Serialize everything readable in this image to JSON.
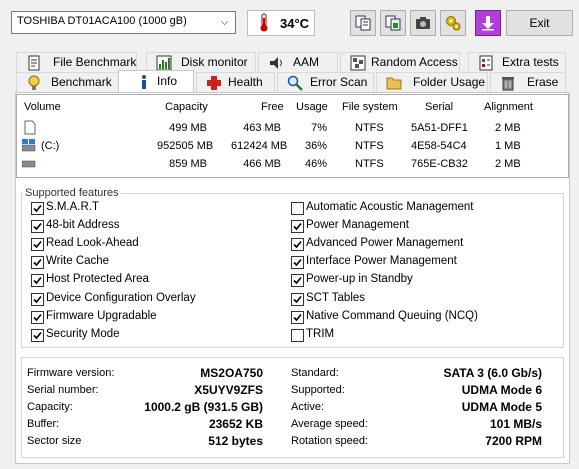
{
  "toolbar": {
    "drive_selected": "TOSHIBA DT01ACA100 (1000 gB)",
    "temperature": "34°C",
    "exit_label": "Exit"
  },
  "tabs_row1": [
    {
      "label": "File Benchmark",
      "icon": "file-benchmark-icon"
    },
    {
      "label": "Disk monitor",
      "icon": "disk-monitor-icon"
    },
    {
      "label": "AAM",
      "icon": "speaker-icon"
    },
    {
      "label": "Random Access",
      "icon": "random-access-icon"
    },
    {
      "label": "Extra tests",
      "icon": "extra-tests-icon"
    }
  ],
  "tabs_row2": [
    {
      "label": "Benchmark",
      "icon": "bulb-icon"
    },
    {
      "label": "Info",
      "icon": "info-icon",
      "active": true
    },
    {
      "label": "Health",
      "icon": "health-cross-icon"
    },
    {
      "label": "Error Scan",
      "icon": "magnifier-icon"
    },
    {
      "label": "Folder Usage",
      "icon": "folder-icon"
    },
    {
      "label": "Erase",
      "icon": "trash-icon"
    }
  ],
  "volumes": {
    "headers": [
      "Volume",
      "Capacity",
      "Free",
      "Usage",
      "File system",
      "Serial",
      "Alignment"
    ],
    "rows": [
      {
        "volume": "",
        "capacity": "499 MB",
        "free": "463 MB",
        "usage": "7%",
        "fs": "NTFS",
        "serial": "5A51-DFF1",
        "alignment": "2 MB"
      },
      {
        "volume": "(C:)",
        "capacity": "952505 MB",
        "free": "612424 MB",
        "usage": "36%",
        "fs": "NTFS",
        "serial": "4E58-54C4",
        "alignment": "1 MB"
      },
      {
        "volume": "",
        "capacity": "859 MB",
        "free": "466 MB",
        "usage": "46%",
        "fs": "NTFS",
        "serial": "765E-CB32",
        "alignment": "2 MB"
      }
    ]
  },
  "features": {
    "title": "Supported features",
    "left": [
      {
        "label": "S.M.A.R.T",
        "checked": true
      },
      {
        "label": "48-bit Address",
        "checked": true
      },
      {
        "label": "Read Look-Ahead",
        "checked": true
      },
      {
        "label": "Write Cache",
        "checked": true
      },
      {
        "label": "Host Protected Area",
        "checked": true
      },
      {
        "label": "Device Configuration Overlay",
        "checked": true
      },
      {
        "label": "Firmware Upgradable",
        "checked": true
      },
      {
        "label": "Security Mode",
        "checked": true
      }
    ],
    "right": [
      {
        "label": "Automatic Acoustic Management",
        "checked": false
      },
      {
        "label": "Power Management",
        "checked": true
      },
      {
        "label": "Advanced Power Management",
        "checked": true
      },
      {
        "label": "Interface Power Management",
        "checked": true
      },
      {
        "label": "Power-up in Standby",
        "checked": true
      },
      {
        "label": "SCT Tables",
        "checked": true
      },
      {
        "label": "Native Command Queuing (NCQ)",
        "checked": true
      },
      {
        "label": "TRIM",
        "checked": false
      }
    ]
  },
  "info": {
    "left": [
      {
        "label": "Firmware version:",
        "value": "MS2OA750"
      },
      {
        "label": "Serial number:",
        "value": "X5UYV9ZFS"
      },
      {
        "label": "Capacity:",
        "value": "1000.2 gB (931.5 GB)"
      },
      {
        "label": "Buffer:",
        "value": "23652 KB"
      },
      {
        "label": "Sector size",
        "value": "512 bytes"
      }
    ],
    "right": [
      {
        "label": "Standard:",
        "value": "SATA 3 (6.0 Gb/s)"
      },
      {
        "label": "Supported:",
        "value": "UDMA Mode 6"
      },
      {
        "label": "Active:",
        "value": "UDMA Mode 5"
      },
      {
        "label": "Average speed:",
        "value": "101 MB/s"
      },
      {
        "label": "Rotation speed:",
        "value": "7200 RPM"
      }
    ]
  },
  "colors": {
    "accent_purple": "#b43fd8",
    "health_red": "#d01f1f",
    "thermometer_red": "#c40000"
  }
}
